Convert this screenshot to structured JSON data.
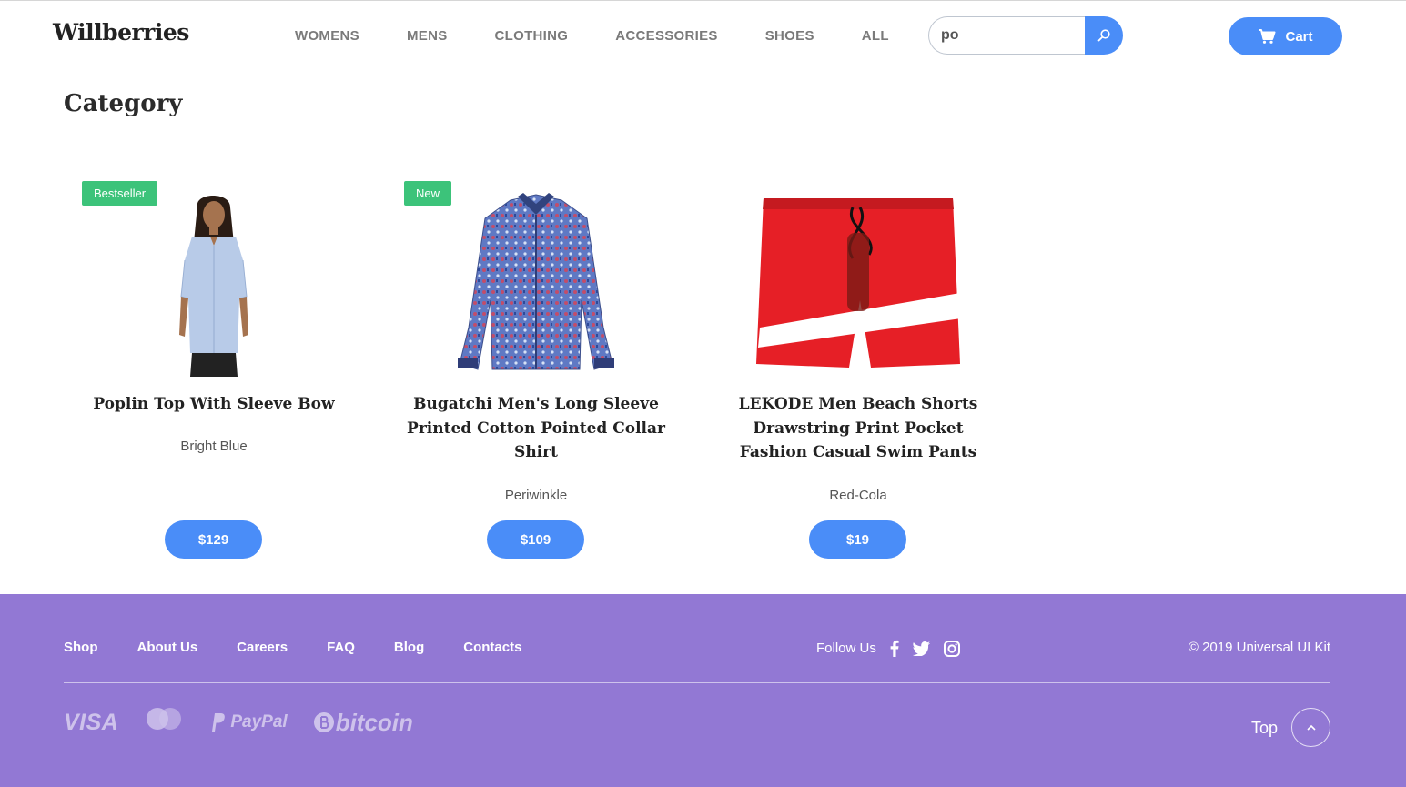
{
  "header": {
    "logo": "Willberries",
    "nav": [
      "WOMENS",
      "MENS",
      "CLOTHING",
      "ACCESSORIES",
      "SHOES",
      "ALL"
    ],
    "search": {
      "value": "po",
      "icon": "search-icon"
    },
    "cart_label": "Cart",
    "accent_color": "#4a8df8"
  },
  "main": {
    "title": "Category",
    "products": [
      {
        "badge": "Bestseller",
        "name": "Poplin Top With Sleeve Bow",
        "color": "Bright Blue",
        "price": "$129"
      },
      {
        "badge": "New",
        "name": "Bugatchi Men's Long Sleeve Printed Cotton Pointed Collar Shirt",
        "color": "Periwinkle",
        "price": "$109"
      },
      {
        "badge": "",
        "name": "LEKODE Men Beach Shorts Drawstring Print Pocket Fashion Casual Swim Pants",
        "color": "Red-Cola",
        "price": "$19"
      }
    ],
    "badge_color": "#3cc37a"
  },
  "footer": {
    "links": [
      "Shop",
      "About Us",
      "Careers",
      "FAQ",
      "Blog",
      "Contacts"
    ],
    "follow_label": "Follow Us",
    "social_icons": [
      "facebook-icon",
      "twitter-icon",
      "instagram-icon"
    ],
    "copyright": "© 2019 Universal UI Kit",
    "payments": {
      "visa": "VISA",
      "mastercard": "mastercard",
      "paypal": "PayPal",
      "bitcoin": "bitcoin"
    },
    "top_label": "Top",
    "background": "#9278d4"
  }
}
